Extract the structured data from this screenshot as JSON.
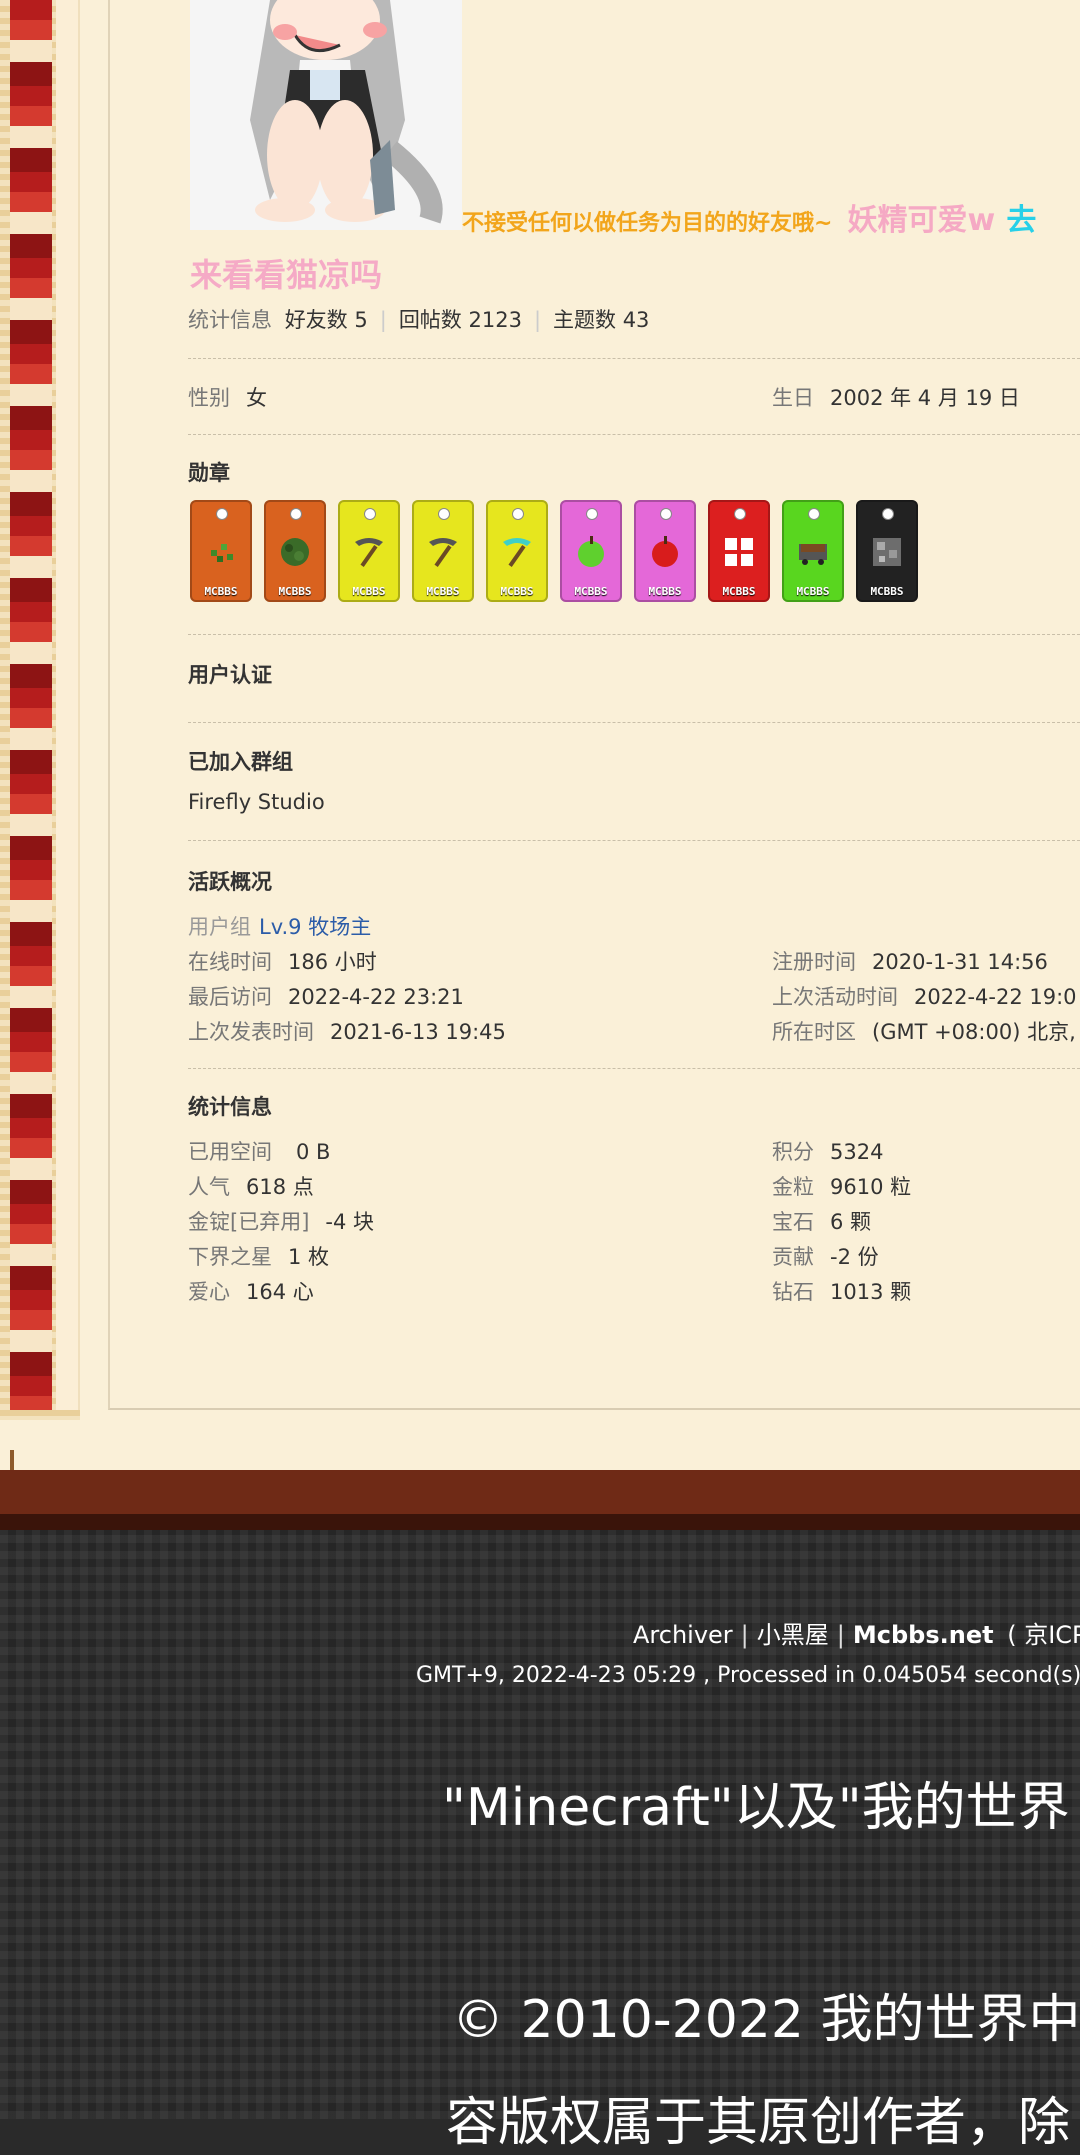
{
  "profile": {
    "signature": {
      "line1_a": "不接受任何以做任务为目的的好友哦~",
      "line1_b": "妖精可爱w",
      "line1_c": "去",
      "line2": "来看看猫凉吗"
    },
    "stats": {
      "label": "统计信息",
      "friends": "好友数 5",
      "replies": "回帖数 2123",
      "threads": "主题数 43"
    },
    "gender": {
      "label": "性别",
      "value": "女"
    },
    "birthday": {
      "label": "生日",
      "value": "2002 年 4 月 19 日"
    },
    "medals_title": "勋章",
    "medals": [
      {
        "color": "#d9621f",
        "item": "leaves-icon",
        "text": "MCBBS"
      },
      {
        "color": "#d9621f",
        "item": "bush-icon",
        "text": "MCBBS"
      },
      {
        "color": "#e6e61e",
        "item": "pickaxe-icon",
        "text": "MCBBS"
      },
      {
        "color": "#e6e61e",
        "item": "pickaxe-icon",
        "text": "MCBBS"
      },
      {
        "color": "#e6e61e",
        "item": "diamond-pickaxe-icon",
        "text": "MCBBS"
      },
      {
        "color": "#e468d8",
        "item": "green-apple-icon",
        "text": "MCBBS"
      },
      {
        "color": "#e468d8",
        "item": "red-apple-icon",
        "text": "MCBBS"
      },
      {
        "color": "#dc1f1f",
        "item": "window-icon",
        "text": "MCBBS"
      },
      {
        "color": "#59d61f",
        "item": "minecart-icon",
        "text": "MCBBS"
      },
      {
        "color": "#222222",
        "item": "ore-icon",
        "text": "MCBBS"
      }
    ],
    "verification_title": "用户认证",
    "groups_title": "已加入群组",
    "group_name": "Firefly Studio",
    "activity_title": "活跃概况",
    "user_group_label": "用户组",
    "user_group_value": "Lv.9 牧场主",
    "online_label": "在线时间",
    "online_value": "186 小时",
    "register_label": "注册时间",
    "register_value": "2020-1-31 14:56",
    "last_visit_label": "最后访问",
    "last_visit_value": "2022-4-22 23:21",
    "last_active_label": "上次活动时间",
    "last_active_value": "2022-4-22 19:0",
    "last_post_label": "上次发表时间",
    "last_post_value": "2021-6-13 19:45",
    "timezone_label": "所在时区",
    "timezone_value": "(GMT +08:00) 北京,",
    "stat_info_title": "统计信息",
    "used_space_label": "已用空间",
    "used_space_value": "0 B",
    "score_label": "积分",
    "score_value": "5324",
    "popularity_label": "人气",
    "popularity_value": "618 点",
    "gold_label": "金粒",
    "gold_value": "9610 粒",
    "ingot_label": "金锭[已弃用]",
    "ingot_value": "-4 块",
    "gem_label": "宝石",
    "gem_value": "6 颗",
    "nether_label": "下界之星",
    "nether_value": "1 枚",
    "contrib_label": "贡献",
    "contrib_value": "-2 份",
    "love_label": "爱心",
    "love_value": "164 心",
    "diamond_label": "钻石",
    "diamond_value": "1013 颗"
  },
  "footer": {
    "archiver": "Archiver",
    "blackroom": "小黑屋",
    "site": "Mcbbs.net",
    "icp": "( 京ICP",
    "time": "GMT+9, 2022-4-23 05:29 , Processed in 0.045054 second(s),",
    "mc_notice": "\"Minecraft\"以及\"我的世界",
    "copyright": "© 2010-2022 我的世界中",
    "copyright2": "容版权属于其原创作者，除"
  }
}
